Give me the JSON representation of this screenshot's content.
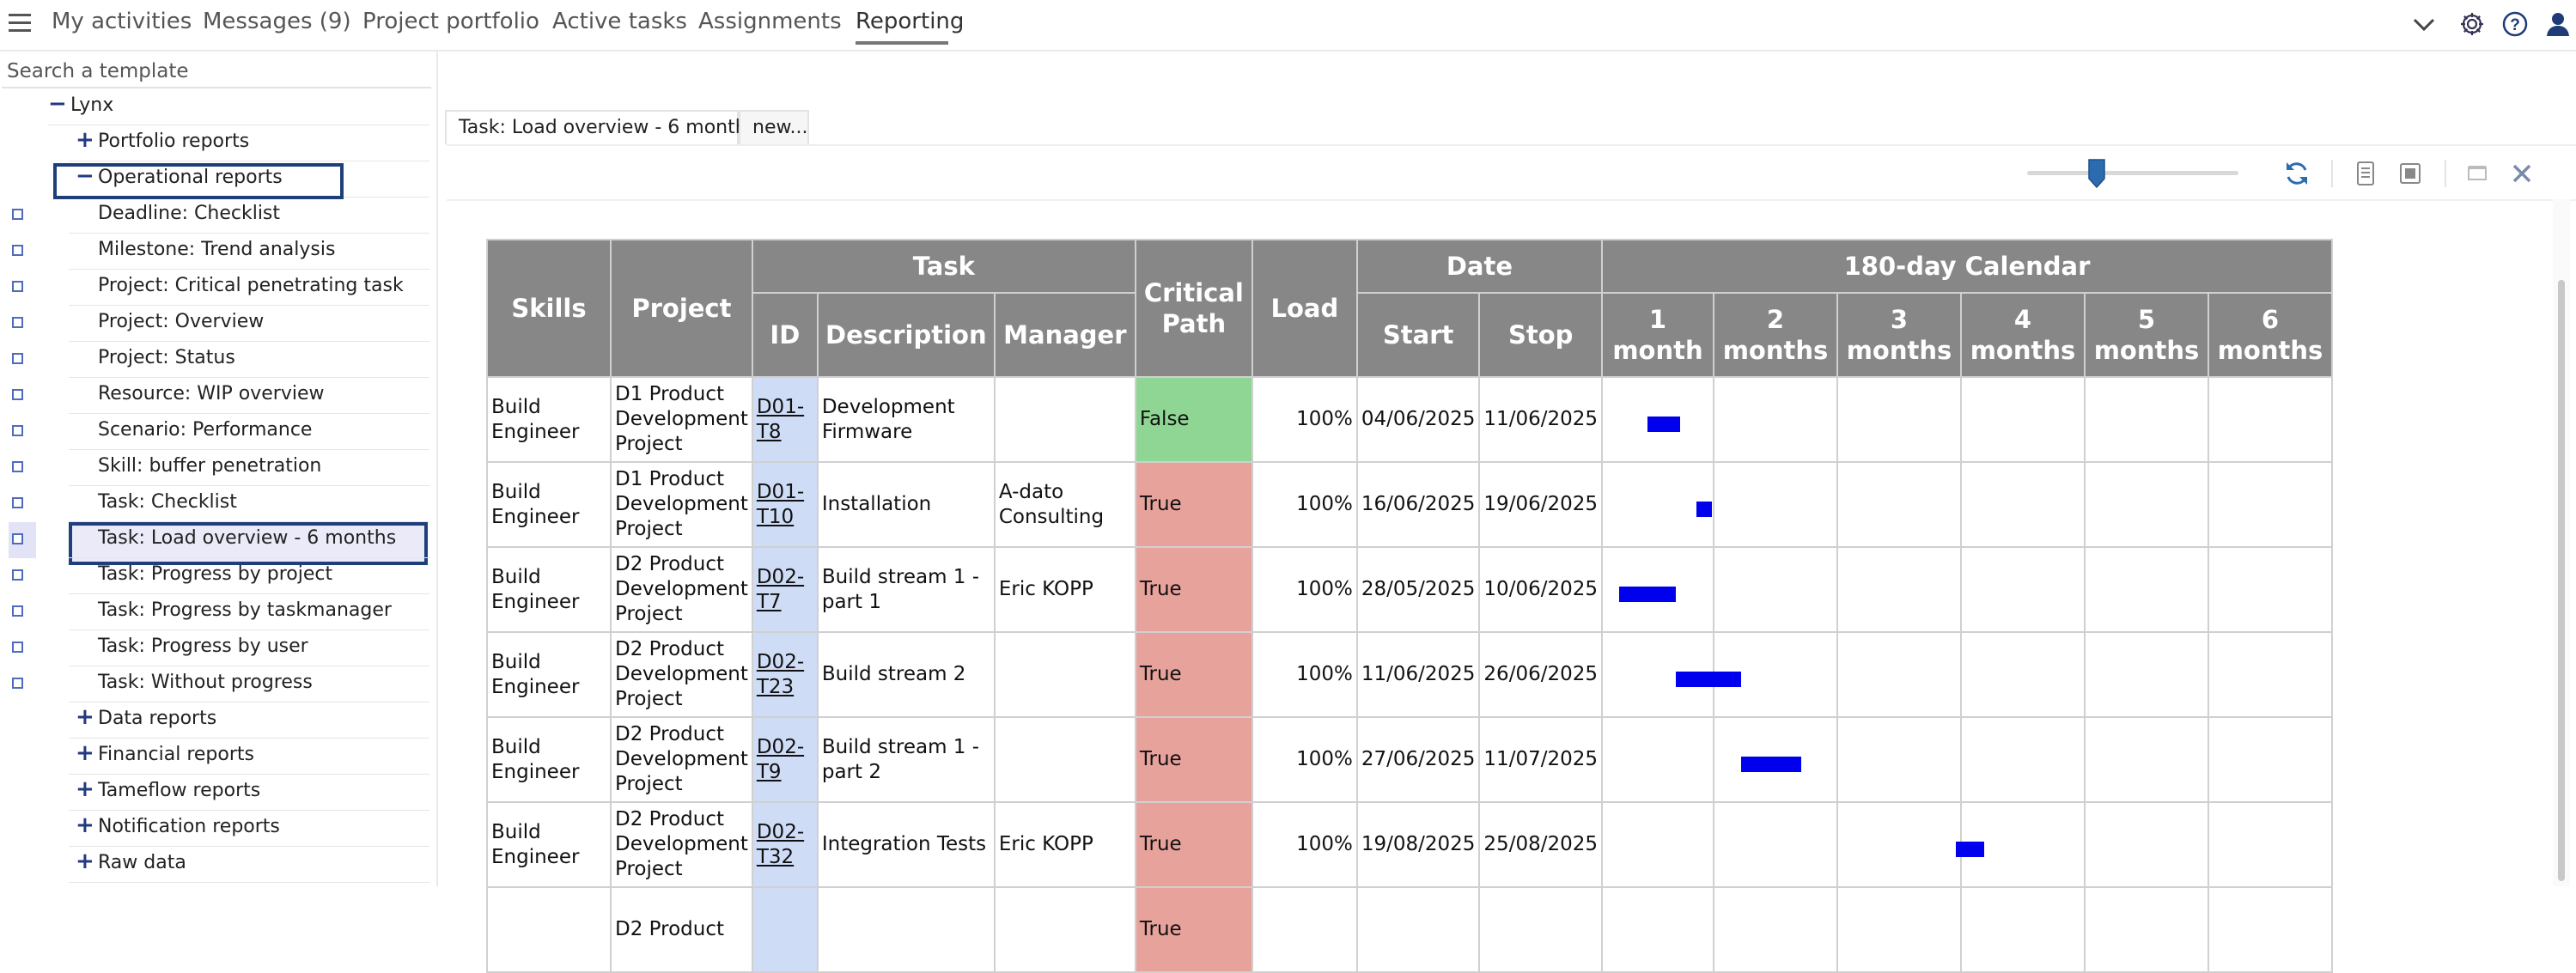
{
  "nav": {
    "items": [
      "My activities",
      "Messages (9)",
      "Project portfolio",
      "Active tasks",
      "Assignments",
      "Reporting"
    ],
    "active": "Reporting"
  },
  "icons": {
    "menu": "hamburger-icon",
    "top_right": [
      "chevron-down-icon",
      "gear-icon",
      "help-icon",
      "user-icon"
    ],
    "toolbar": [
      "refresh-icon",
      "document-icon",
      "export-icon",
      "window-icon",
      "close-icon"
    ]
  },
  "colors": {
    "highlight_border": "#1e3f7a",
    "critical_false": "#8fd694",
    "critical_true": "#e8a29c",
    "id_column": "#cfdcf6",
    "header": "#878787",
    "gantt_bar": "#0000ee",
    "accent": "#2b6cb0"
  },
  "sidebar": {
    "search_placeholder": "Search a template",
    "root": "Lynx",
    "items": [
      {
        "label": "Portfolio reports",
        "type": "folder",
        "expanded": false
      },
      {
        "label": "Operational reports",
        "type": "folder",
        "expanded": true
      },
      {
        "label": "Deadline: Checklist",
        "type": "report"
      },
      {
        "label": "Milestone: Trend analysis",
        "type": "report"
      },
      {
        "label": "Project: Critical penetrating task",
        "type": "report"
      },
      {
        "label": "Project: Overview",
        "type": "report"
      },
      {
        "label": "Project: Status",
        "type": "report"
      },
      {
        "label": "Resource: WIP overview",
        "type": "report"
      },
      {
        "label": "Scenario: Performance",
        "type": "report"
      },
      {
        "label": "Skill: buffer penetration",
        "type": "report"
      },
      {
        "label": "Task: Checklist",
        "type": "report"
      },
      {
        "label": "Task: Load overview - 6 months",
        "type": "report",
        "selected": true
      },
      {
        "label": "Task: Progress by project",
        "type": "report"
      },
      {
        "label": "Task: Progress by taskmanager",
        "type": "report"
      },
      {
        "label": "Task: Progress by user",
        "type": "report"
      },
      {
        "label": "Task: Without progress",
        "type": "report"
      },
      {
        "label": "Data reports",
        "type": "folder",
        "expanded": false
      },
      {
        "label": "Financial reports",
        "type": "folder",
        "expanded": false
      },
      {
        "label": "Tameflow reports",
        "type": "folder",
        "expanded": false
      },
      {
        "label": "Notification reports",
        "type": "folder",
        "expanded": false
      },
      {
        "label": "Raw data",
        "type": "folder",
        "expanded": false
      }
    ]
  },
  "tabs": [
    {
      "label": "Task: Load overview - 6 months",
      "active": true
    },
    {
      "label": "new...",
      "active": false
    }
  ],
  "toolbar": {
    "zoom_fraction": 0.33
  },
  "table": {
    "group_headers": {
      "skills": "Skills",
      "project": "Project",
      "task": "Task",
      "critical": "Critical Path",
      "load": "Load",
      "date": "Date",
      "calendar": "180-day Calendar"
    },
    "sub_headers": {
      "id": "ID",
      "description": "Description",
      "manager": "Manager",
      "start": "Start",
      "stop": "Stop"
    },
    "months": [
      "1 month",
      "2 months",
      "3 months",
      "4 months",
      "5 months",
      "6 months"
    ],
    "calendar_origin": "2025-05-24",
    "calendar_days": 180,
    "rows": [
      {
        "skills": "Build Engineer",
        "project": "D1 Product Development Project",
        "id": "D01-T8",
        "description": "Development Firmware",
        "manager": "",
        "critical": "False",
        "load": "100%",
        "start": "04/06/2025",
        "stop": "11/06/2025"
      },
      {
        "skills": "Build Engineer",
        "project": "D1 Product Development Project",
        "id": "D01-T10",
        "description": "Installation",
        "manager": "A-dato Consulting",
        "critical": "True",
        "load": "100%",
        "start": "16/06/2025",
        "stop": "19/06/2025"
      },
      {
        "skills": "Build Engineer",
        "project": "D2 Product Development Project",
        "id": "D02-T7",
        "description": "Build stream 1 - part 1",
        "manager": "Eric KOPP",
        "critical": "True",
        "load": "100%",
        "start": "28/05/2025",
        "stop": "10/06/2025"
      },
      {
        "skills": "Build Engineer",
        "project": "D2 Product Development Project",
        "id": "D02-T23",
        "description": "Build stream 2",
        "manager": "",
        "critical": "True",
        "load": "100%",
        "start": "11/06/2025",
        "stop": "26/06/2025"
      },
      {
        "skills": "Build Engineer",
        "project": "D2 Product Development Project",
        "id": "D02-T9",
        "description": "Build stream 1 - part 2",
        "manager": "",
        "critical": "True",
        "load": "100%",
        "start": "27/06/2025",
        "stop": "11/07/2025"
      },
      {
        "skills": "Build Engineer",
        "project": "D2 Product Development Project",
        "id": "D02-T32",
        "description": "Integration Tests",
        "manager": "Eric KOPP",
        "critical": "True",
        "load": "100%",
        "start": "19/08/2025",
        "stop": "25/08/2025"
      },
      {
        "skills": "",
        "project": "D2 Product",
        "id": "",
        "description": "",
        "manager": "",
        "critical": "True",
        "load": "",
        "start": "",
        "stop": ""
      }
    ]
  }
}
